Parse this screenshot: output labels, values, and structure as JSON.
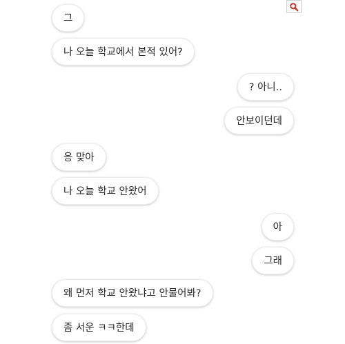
{
  "messages": [
    {
      "text": "그",
      "side": "received"
    },
    {
      "text": "나 오늘 학교에서 본적 있어?",
      "side": "received"
    },
    {
      "text": "? 아니..",
      "side": "sent"
    },
    {
      "text": "안보이던데",
      "side": "sent"
    },
    {
      "text": "응 맞아",
      "side": "received"
    },
    {
      "text": "나 오늘 학교 안왔어",
      "side": "received"
    },
    {
      "text": "아",
      "side": "sent"
    },
    {
      "text": "그래",
      "side": "sent"
    },
    {
      "text": "왜 먼저 학교 안왔냐고 안물어봐?",
      "side": "received"
    },
    {
      "text": "좀 서운 ㅋㅋ한데",
      "side": "received"
    }
  ],
  "toolbar": {
    "search_icon": "search-icon",
    "icon_color": "#c0392b"
  }
}
